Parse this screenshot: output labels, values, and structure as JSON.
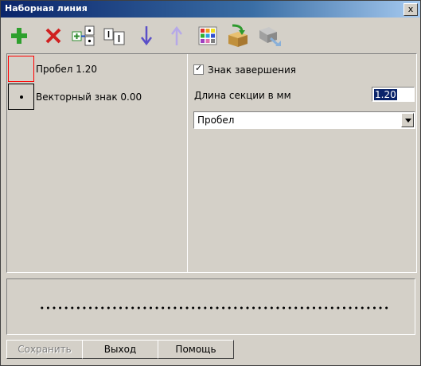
{
  "window": {
    "title": "Наборная линия",
    "close_glyph": "x"
  },
  "toolbar": {
    "buttons": [
      {
        "icon": "add-icon"
      },
      {
        "icon": "delete-icon"
      },
      {
        "icon": "insert-symbol-icon"
      },
      {
        "icon": "insert-space-icon"
      },
      {
        "icon": "move-down-icon"
      },
      {
        "icon": "move-up-icon"
      },
      {
        "icon": "palette-icon"
      },
      {
        "icon": "load-from-library-icon"
      },
      {
        "icon": "save-to-library-icon"
      }
    ]
  },
  "list": {
    "items": [
      {
        "label": "Пробел 1.20",
        "swatch": "red-frame"
      },
      {
        "label": "Векторный знак 0.00",
        "swatch": "dot"
      }
    ]
  },
  "properties": {
    "end_mark_label": "Знак завершения",
    "end_mark_checked": true,
    "check_glyph": "✓",
    "length_label": "Длина секции в мм",
    "length_value": "1.20",
    "type_value": "Пробел"
  },
  "buttons": {
    "save": "Сохранить",
    "exit": "Выход",
    "help": "Помощь"
  },
  "colors": {
    "face": "#d4d0c8",
    "title_start": "#0a246a",
    "selection": "#0a246a",
    "add_icon": "#2ea02e",
    "delete_icon": "#d02020"
  }
}
